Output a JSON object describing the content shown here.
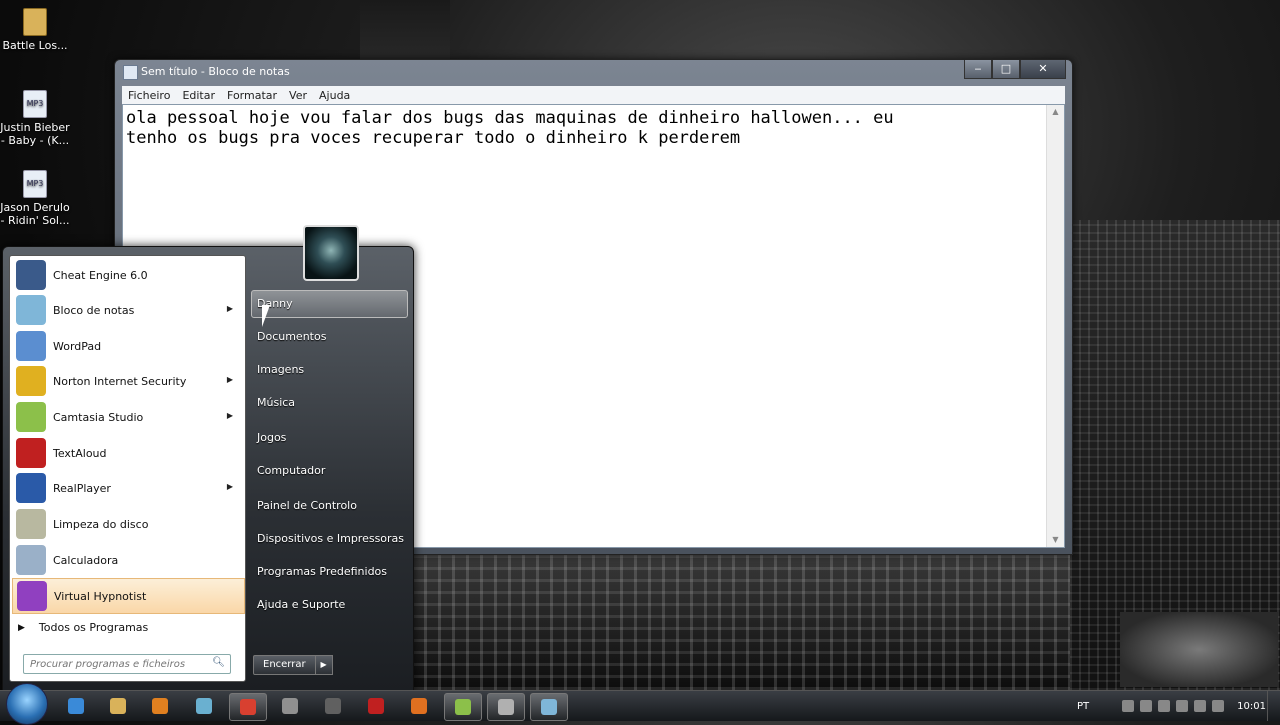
{
  "desktop": {
    "icons": [
      {
        "label": "Battle Los...",
        "icon": "folder-icon"
      },
      {
        "label": "Justin Bieber - Baby - (K...",
        "icon": "mp3-file-icon"
      },
      {
        "label": "Jason Derulo - Ridin' Sol...",
        "icon": "mp3-file-icon"
      }
    ]
  },
  "notepad": {
    "title": "Sem título - Bloco de notas",
    "menu": [
      "Ficheiro",
      "Editar",
      "Formatar",
      "Ver",
      "Ajuda"
    ],
    "content": "ola pessoal hoje vou falar dos bugs das maquinas de dinheiro hallowen... eu\ntenho os bugs pra voces recuperar todo o dinheiro k perderem",
    "controls": {
      "minimize": "‒",
      "maximize": "□",
      "close": "✕"
    }
  },
  "start_menu": {
    "programs": [
      {
        "label": "Cheat Engine 6.0",
        "has_submenu": false,
        "color": "#3a5a8a"
      },
      {
        "label": "Bloco de notas",
        "has_submenu": true,
        "color": "#7fb6d8"
      },
      {
        "label": "WordPad",
        "has_submenu": false,
        "color": "#5b8ed0"
      },
      {
        "label": "Norton Internet Security",
        "has_submenu": true,
        "color": "#e0b020"
      },
      {
        "label": "Camtasia Studio",
        "has_submenu": true,
        "color": "#8cc04a"
      },
      {
        "label": "TextAloud",
        "has_submenu": false,
        "color": "#c02020"
      },
      {
        "label": "RealPlayer",
        "has_submenu": true,
        "color": "#2a5aa8"
      },
      {
        "label": "Limpeza do disco",
        "has_submenu": false,
        "color": "#b8b8a0"
      },
      {
        "label": "Calculadora",
        "has_submenu": false,
        "color": "#9ab0c8"
      },
      {
        "label": "Virtual Hypnotist",
        "has_submenu": false,
        "color": "#9040c0"
      }
    ],
    "all_programs": "Todos os Programas",
    "search_placeholder": "Procurar programas e ficheiros",
    "right_items": [
      "Danny",
      "Documentos",
      "Imagens",
      "Música",
      "Jogos",
      "Computador",
      "Painel de Controlo",
      "Dispositivos e Impressoras",
      "Programas Predefinidos",
      "Ajuda e Suporte"
    ],
    "shutdown_label": "Encerrar"
  },
  "taskbar": {
    "buttons": [
      {
        "icon": "internet-explorer-icon",
        "color": "#3a8ad8"
      },
      {
        "icon": "explorer-folder-icon",
        "color": "#d9b25a"
      },
      {
        "icon": "media-player-icon",
        "color": "#e08020"
      },
      {
        "icon": "drive-icon",
        "color": "#6ab0d0"
      },
      {
        "icon": "chrome-icon",
        "color": "#d84030"
      },
      {
        "icon": "app-icon",
        "color": "#909090"
      },
      {
        "icon": "media-center-icon",
        "color": "#606060"
      },
      {
        "icon": "flash-icon",
        "color": "#c02020"
      },
      {
        "icon": "firefox-icon",
        "color": "#e07020"
      },
      {
        "icon": "camtasia-icon",
        "color": "#8cc04a"
      },
      {
        "icon": "tool-icon",
        "color": "#b0b0b0"
      },
      {
        "icon": "notepad-icon",
        "color": "#7fb6d8"
      }
    ],
    "language": "PT",
    "clock": "10:01"
  }
}
